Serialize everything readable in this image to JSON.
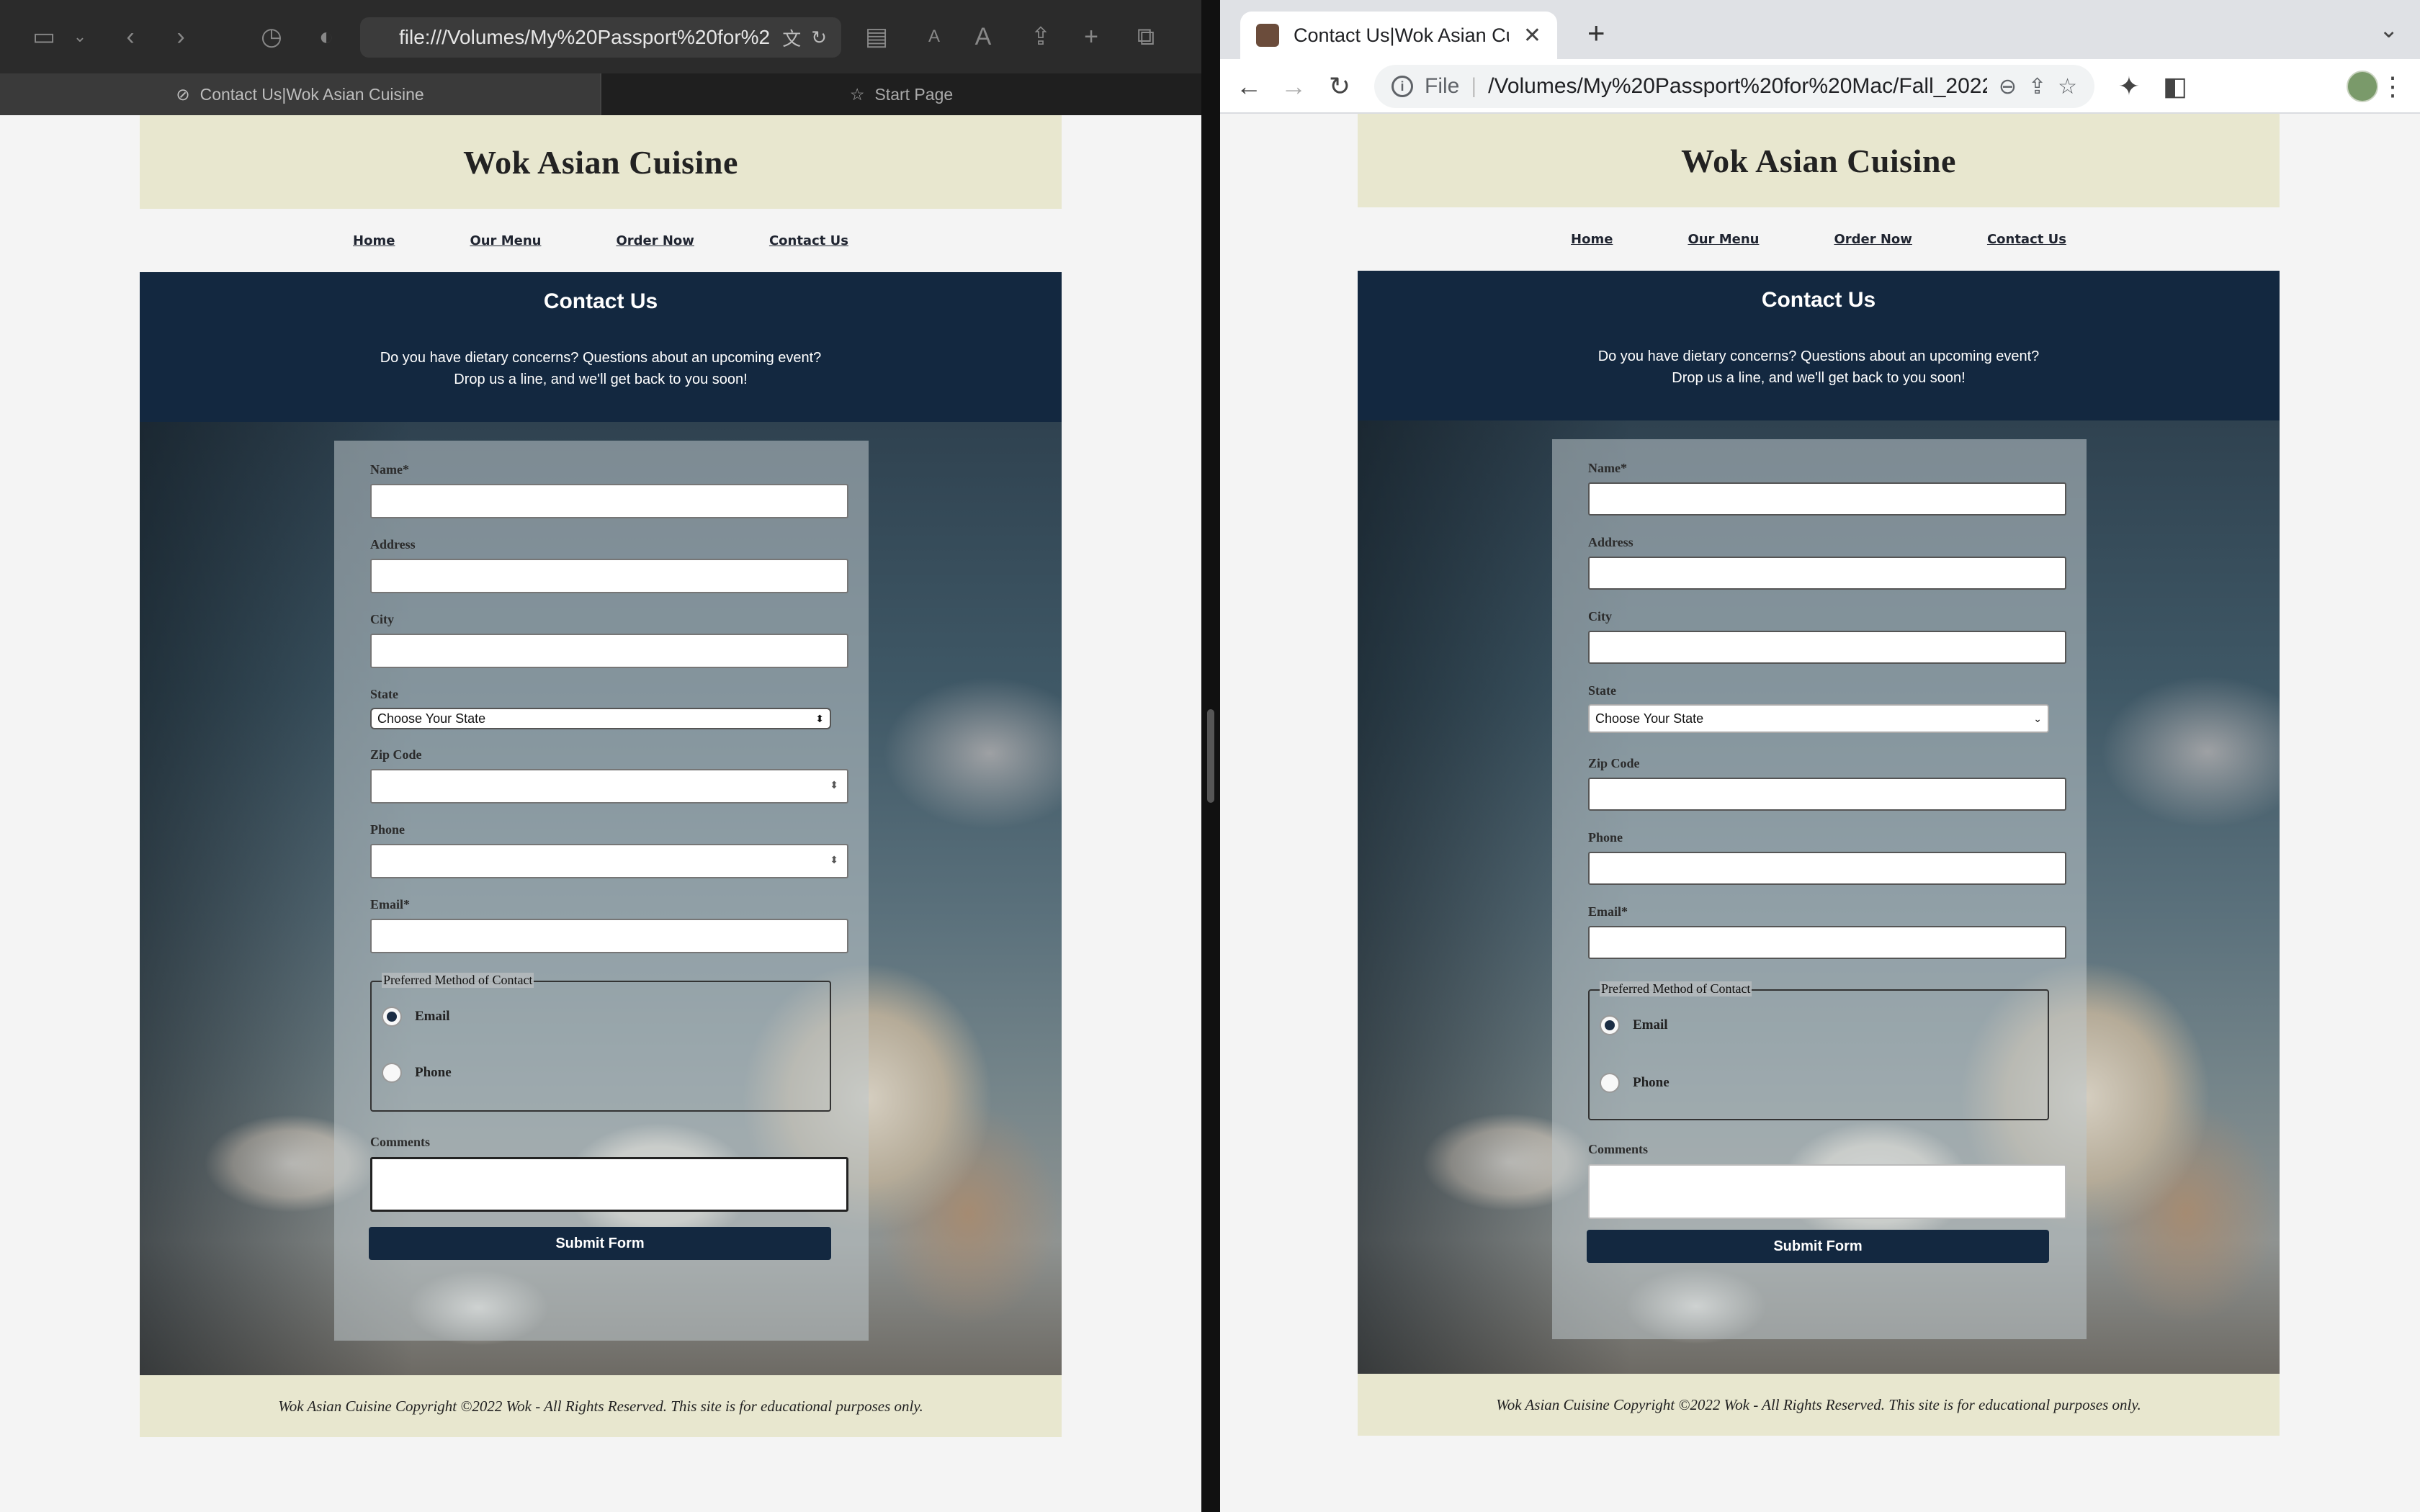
{
  "safari": {
    "address_bar": "file:///Volumes/My%20Passport%20for%2",
    "tabs": [
      {
        "label": "Contact Us|Wok Asian Cuisine"
      },
      {
        "label": "Start Page"
      }
    ]
  },
  "chrome": {
    "tab_title": "Contact Us|Wok Asian Cuisine",
    "scheme": "File",
    "address": "/Volumes/My%20Passport%20for%20Mac/Fall_2022/Sessio..."
  },
  "site": {
    "title": "Wok Asian Cuisine",
    "nav": [
      "Home",
      "Our Menu",
      "Order Now",
      "Contact Us"
    ],
    "contact_title": "Contact Us",
    "intro_line1": "Do you have dietary concerns? Questions about an upcoming event?",
    "intro_line2": "Drop us a line, and we'll get back to you soon!",
    "form": {
      "name_label": "Name*",
      "address_label": "Address",
      "city_label": "City",
      "state_label": "State",
      "state_selected": "Choose Your State",
      "zip_label": "Zip Code",
      "phone_label": "Phone",
      "email_label": "Email*",
      "contact_method_legend": "Preferred Method of Contact",
      "contact_methods": [
        {
          "label": "Email",
          "selected": true
        },
        {
          "label": "Phone",
          "selected": false
        }
      ],
      "comments_label": "Comments",
      "submit_label": "Submit Form"
    },
    "footer": "Wok Asian Cuisine Copyright ©2022 Wok - All Rights Reserved. This site is for educational purposes only."
  },
  "colors": {
    "header_bg": "#e8e7cf",
    "navy": "#132840"
  }
}
